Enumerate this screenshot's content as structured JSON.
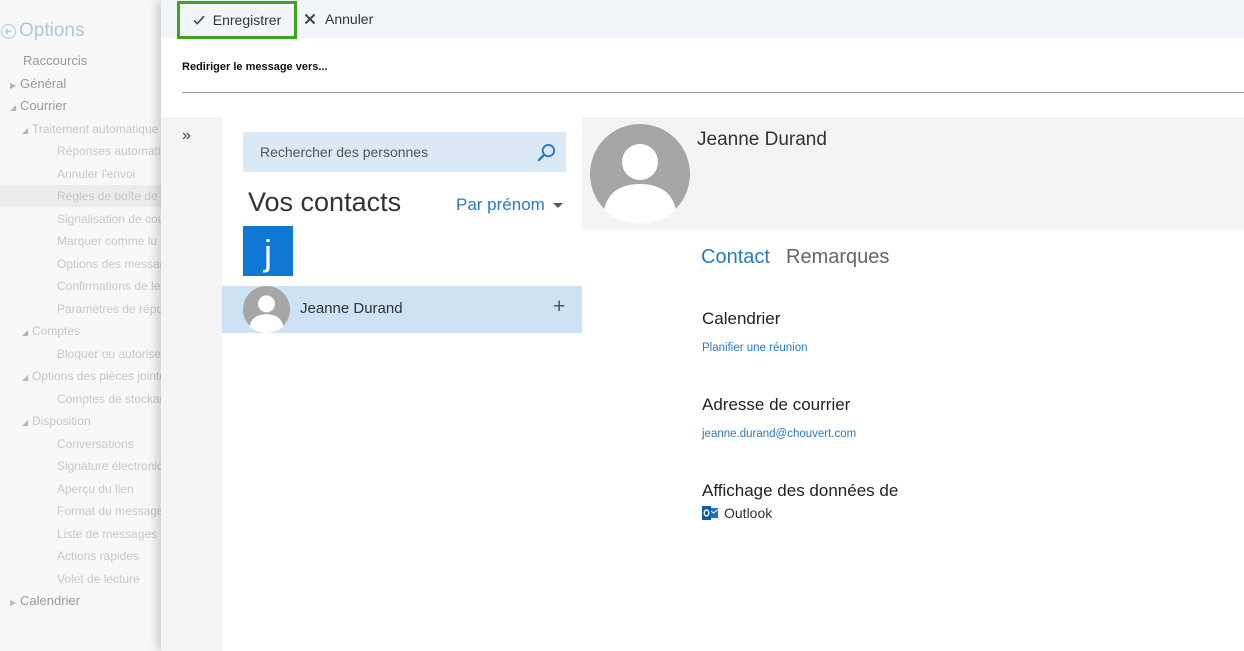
{
  "options": {
    "title": "Options",
    "items": [
      {
        "label": "Raccourcis",
        "level": "top",
        "caret": ""
      },
      {
        "label": "Général",
        "level": "top",
        "caret": "▶"
      },
      {
        "label": "Courrier",
        "level": "top",
        "caret": "◢"
      },
      {
        "label": "Traitement automatique",
        "level": "sub",
        "caret": "◢"
      },
      {
        "label": "Réponses automatiques",
        "level": "leaf",
        "caret": ""
      },
      {
        "label": "Annuler l'envoi",
        "level": "leaf",
        "caret": ""
      },
      {
        "label": "Règles de boîte de réception",
        "level": "leaf",
        "caret": "",
        "selected": true
      },
      {
        "label": "Signalisation de courrier",
        "level": "leaf",
        "caret": ""
      },
      {
        "label": "Marquer comme lu",
        "level": "leaf",
        "caret": ""
      },
      {
        "label": "Options des messages",
        "level": "leaf",
        "caret": ""
      },
      {
        "label": "Confirmations de lecture",
        "level": "leaf",
        "caret": ""
      },
      {
        "label": "Paramètres de réponse",
        "level": "leaf",
        "caret": ""
      },
      {
        "label": "Comptes",
        "level": "sub",
        "caret": "◢"
      },
      {
        "label": "Bloquer ou autoriser",
        "level": "leaf",
        "caret": ""
      },
      {
        "label": "Options des pièces jointes",
        "level": "sub",
        "caret": "◢"
      },
      {
        "label": "Comptes de stockage",
        "level": "leaf",
        "caret": ""
      },
      {
        "label": "Disposition",
        "level": "sub",
        "caret": "◢"
      },
      {
        "label": "Conversations",
        "level": "leaf",
        "caret": ""
      },
      {
        "label": "Signature électronique",
        "level": "leaf",
        "caret": ""
      },
      {
        "label": "Aperçu du lien",
        "level": "leaf",
        "caret": ""
      },
      {
        "label": "Format du message",
        "level": "leaf",
        "caret": ""
      },
      {
        "label": "Liste de messages",
        "level": "leaf",
        "caret": ""
      },
      {
        "label": "Actions rapides",
        "level": "leaf",
        "caret": ""
      },
      {
        "label": "Volet de lecture",
        "level": "leaf",
        "caret": ""
      },
      {
        "label": "Calendrier",
        "level": "top",
        "caret": "▶"
      }
    ]
  },
  "toolbar": {
    "save_label": "Enregistrer",
    "cancel_label": "Annuler"
  },
  "redirect": {
    "label": "Rediriger le message vers..."
  },
  "picker": {
    "expand_glyph": "»",
    "search_placeholder": "Rechercher des personnes",
    "heading": "Vos contacts",
    "sort_label": "Par prénom",
    "letter": "j",
    "contacts": [
      {
        "name": "Jeanne Durand",
        "add_glyph": "+"
      }
    ]
  },
  "detail": {
    "name": "Jeanne Durand",
    "tabs": {
      "contact": "Contact",
      "notes": "Remarques"
    },
    "calendar_heading": "Calendrier",
    "calendar_link": "Planifier une réunion",
    "email_heading": "Adresse de courrier",
    "email": "jeanne.durand@chouvert.com",
    "source_heading": "Affichage des données de",
    "source_name": "Outlook"
  },
  "colors": {
    "accent": "#2a7ac2",
    "save_highlight": "#3aa51e",
    "letter_tile": "#0f77d4",
    "selected_row": "#cde2f5"
  }
}
